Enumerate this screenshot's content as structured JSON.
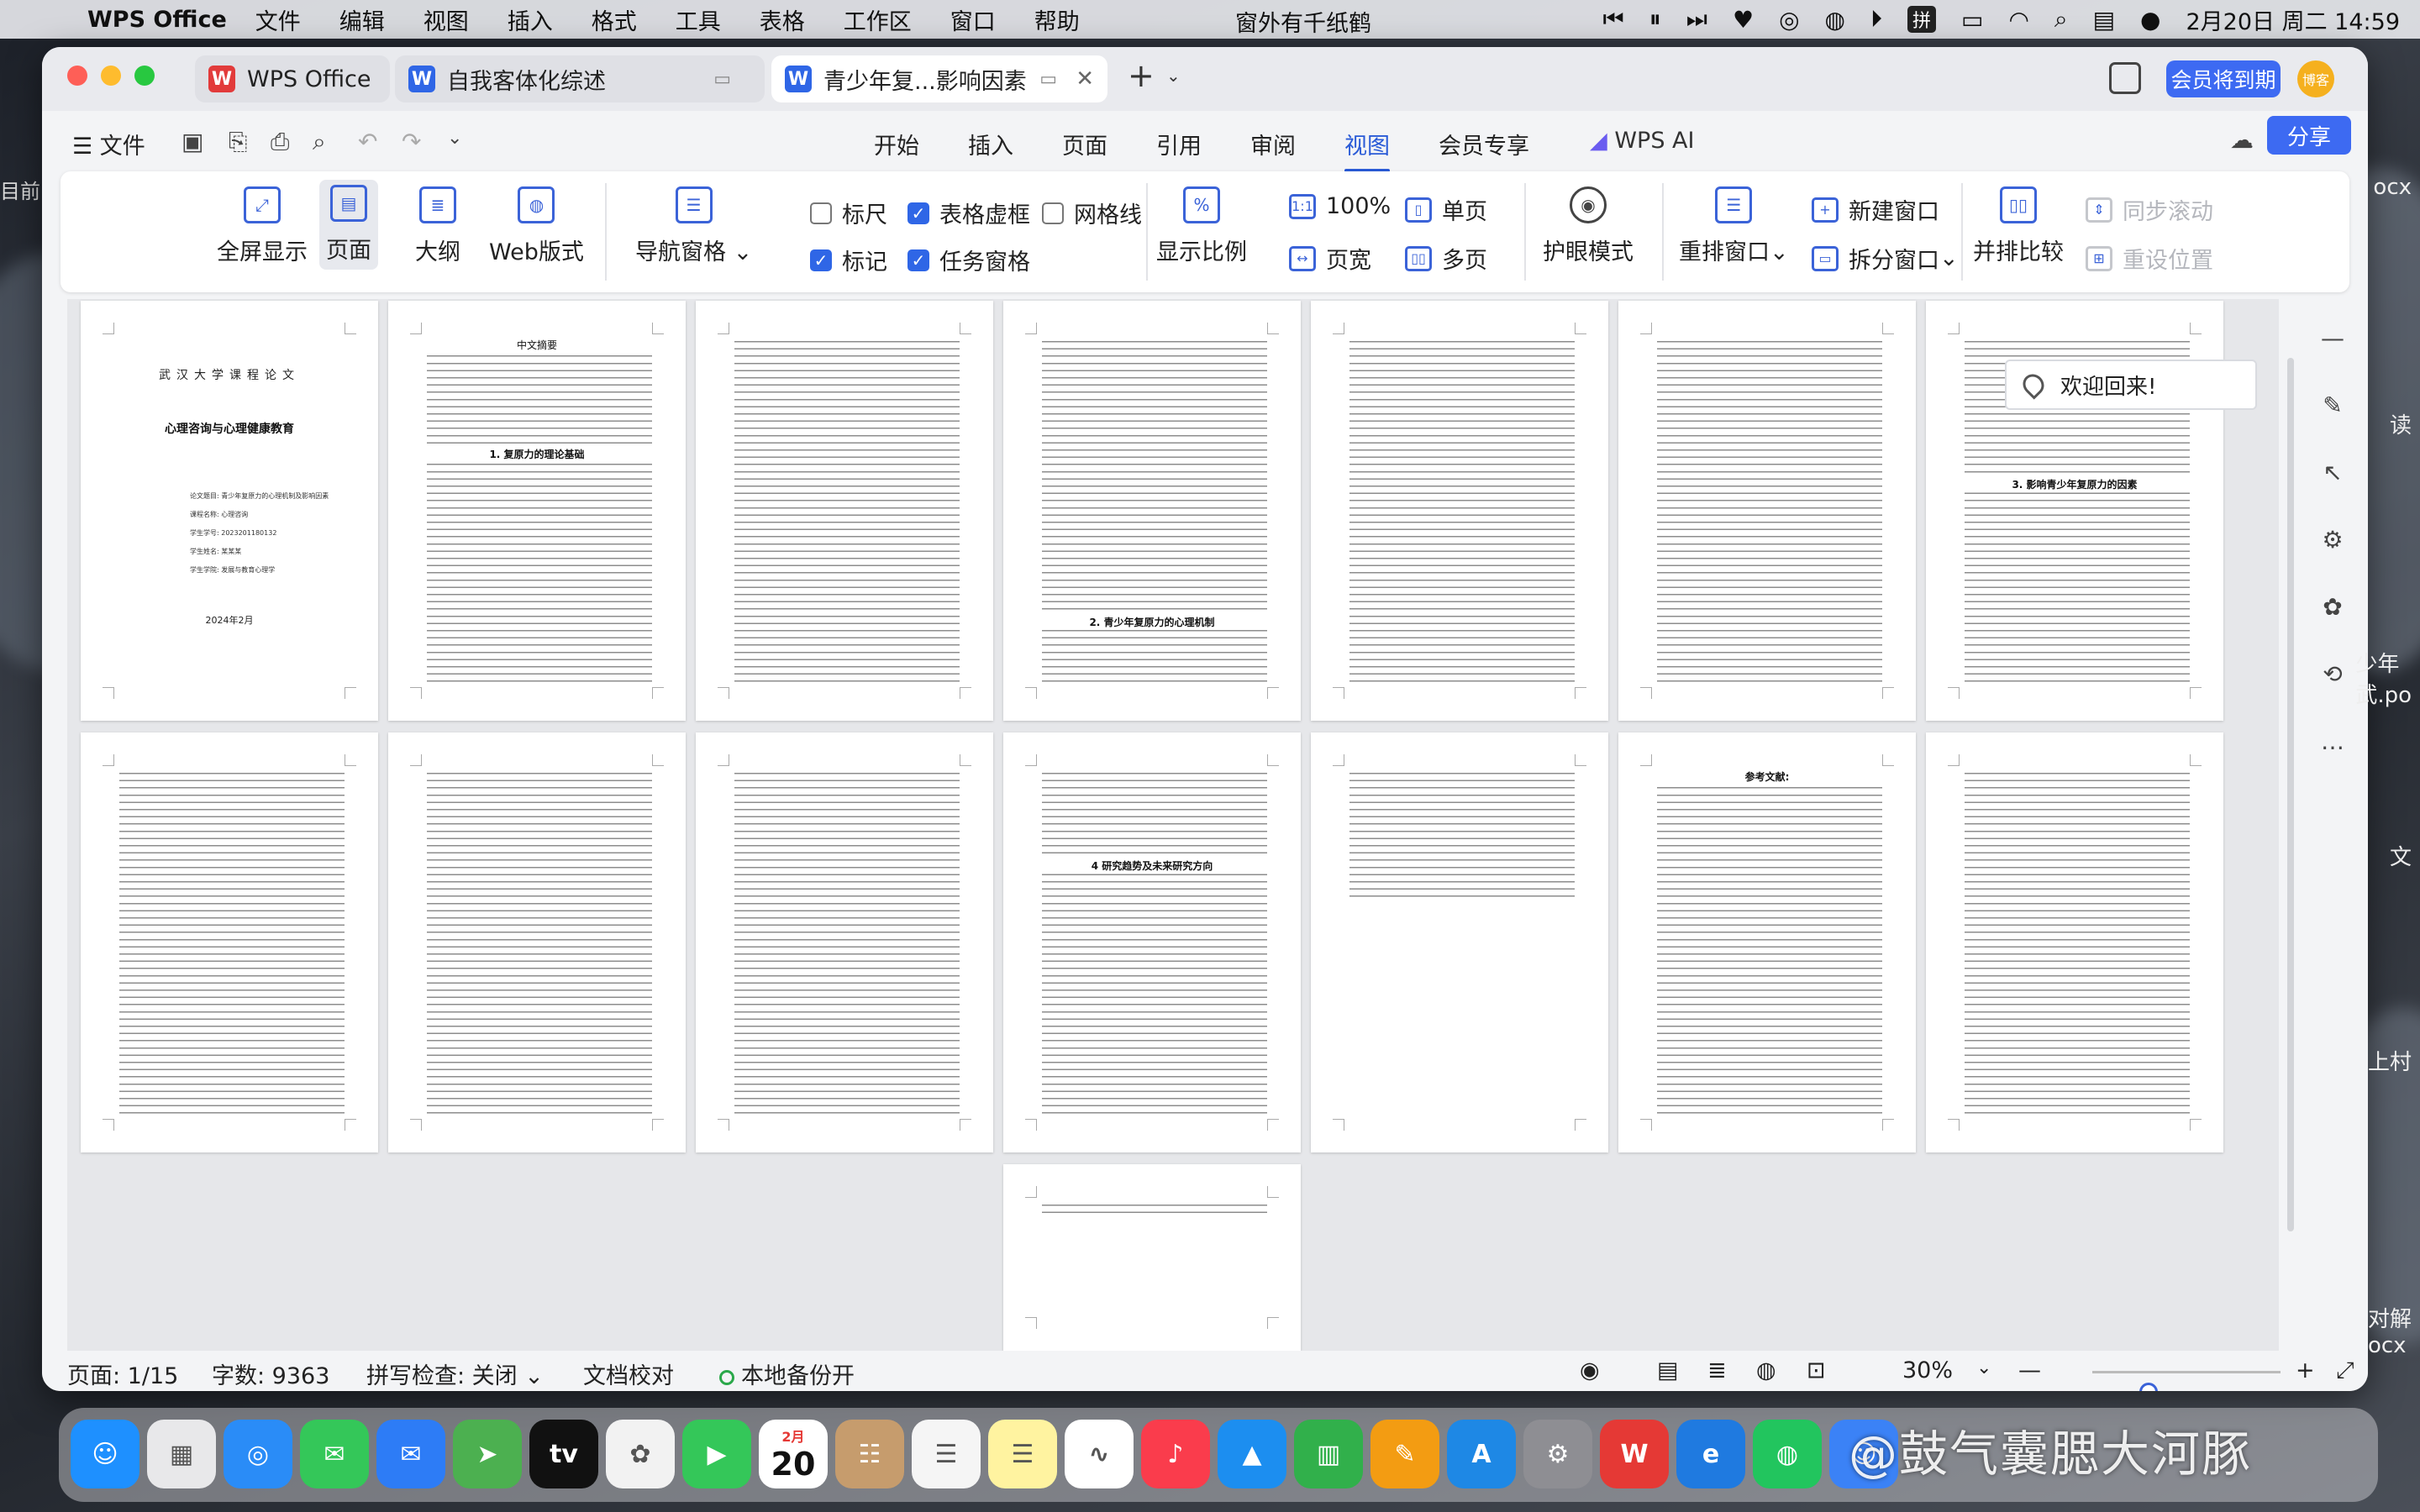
{
  "menubar": {
    "app_name": "WPS Office",
    "menus": [
      "文件",
      "编辑",
      "视图",
      "插入",
      "格式",
      "工具",
      "表格",
      "工作区",
      "窗口",
      "帮助"
    ],
    "center_text": "窗外有千纸鹤",
    "datetime": "2月20日 周二  14:59"
  },
  "tabs": [
    {
      "label": "WPS Office",
      "logo": "W",
      "color": "#e23b3b"
    },
    {
      "label": "自我客体化综述",
      "logo": "W",
      "color": "#2f66e6"
    },
    {
      "label": "青少年复...影响因素",
      "logo": "W",
      "color": "#2f66e6"
    }
  ],
  "window_controls": {
    "vip_label": "会员将到期",
    "avatar_text": "博客",
    "share_label": "分享"
  },
  "menu_row": {
    "file_label": "文件",
    "tabs": [
      "开始",
      "插入",
      "页面",
      "引用",
      "审阅",
      "视图",
      "会员专享"
    ],
    "active_tab": "视图",
    "ai_label": "WPS AI"
  },
  "ribbon": {
    "views": [
      "全屏显示",
      "页面",
      "大纲",
      "Web版式"
    ],
    "nav_pane": "导航窗格",
    "checks": [
      {
        "label": "标尺",
        "checked": false
      },
      {
        "label": "表格虚框",
        "checked": true
      },
      {
        "label": "网格线",
        "checked": false
      },
      {
        "label": "标记",
        "checked": true
      },
      {
        "label": "任务窗格",
        "checked": true
      }
    ],
    "zoom_label": "显示比例",
    "zoom_100": "100%",
    "page_width": "页宽",
    "single_page": "单页",
    "multi_page": "多页",
    "eye_mode": "护眼模式",
    "rearrange": "重排窗口",
    "new_window": "新建窗口",
    "split_window": "拆分窗口",
    "compare": "并排比较",
    "sync_scroll": "同步滚动",
    "reset_position": "重设位置"
  },
  "document": {
    "cover": {
      "university": "武汉大学课程论文",
      "course": "心理咨询与心理健康教育",
      "info_lines": [
        "论文题目: 青少年复原力的心理机制及影响因素",
        "课程名称: 心理咨询",
        "学生学号: 2023201180132",
        "学生姓名: 某某某",
        "学生学院: 发展与教育心理学"
      ],
      "date": "2024年2月"
    },
    "abstract_head": "中文摘要",
    "section_1": "1. 复原力的理论基础",
    "section_2": "2. 青少年复原力的心理机制",
    "section_3": "3. 影响青少年复原力的因素",
    "section_4": "4 研究趋势及未来研究方向",
    "refs_head": "参考文献:",
    "welcome": "欢迎回来!"
  },
  "status": {
    "page": "页面: 1/15",
    "words": "字数: 9363",
    "spell": "拼写检查: 关闭",
    "proof": "文档校对",
    "backup": "本地备份开",
    "zoom": "30%",
    "zoom_level": 0.3
  },
  "overlay": {
    "watermark": "@鼓气囊腮大河豚"
  },
  "dock_icons": [
    "finder",
    "launchpad",
    "safari",
    "messages",
    "mail",
    "maps",
    "tv",
    "photos",
    "facetime",
    "calendar",
    "contacts",
    "reminders",
    "notes",
    "freeform",
    "music",
    "keynote",
    "numbers",
    "pages",
    "app-store",
    "settings",
    "wps",
    "edge",
    "wechat",
    "finder-right"
  ],
  "calendar": {
    "month": "2月",
    "day": "20"
  }
}
